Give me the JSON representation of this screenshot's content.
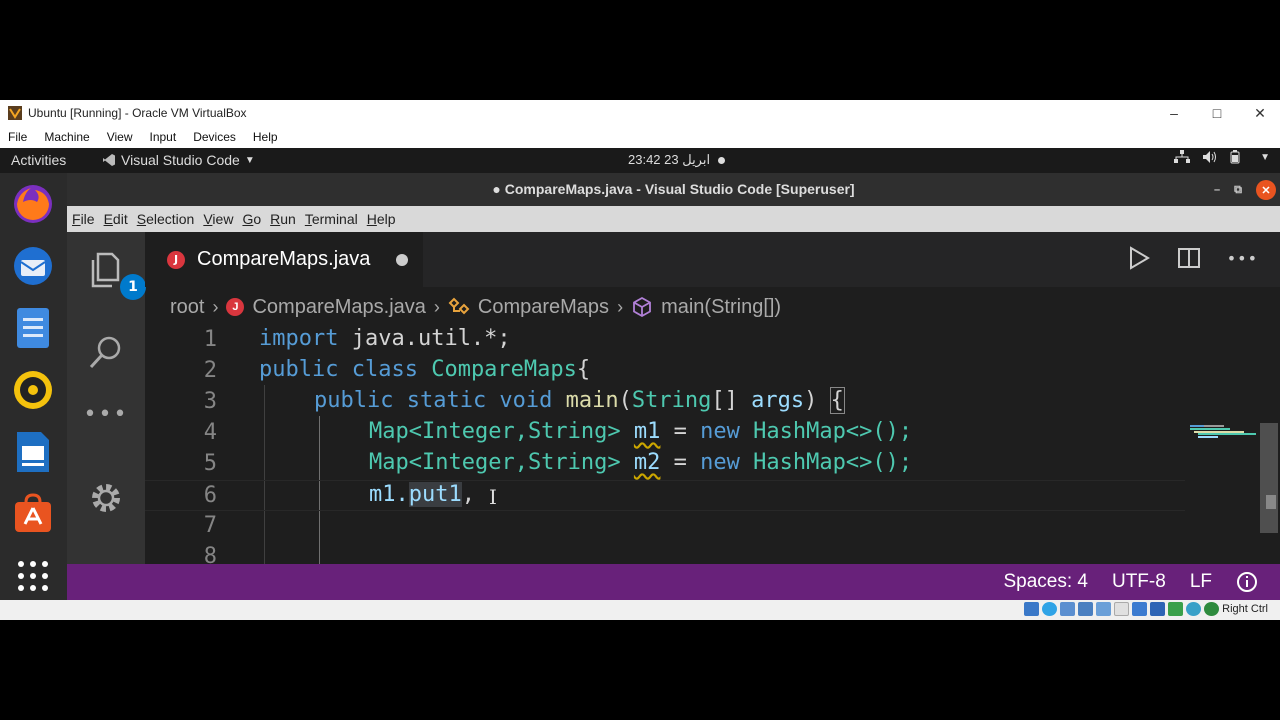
{
  "host_window": {
    "title": "Ubuntu [Running] - Oracle VM VirtualBox",
    "menu": [
      "File",
      "Machine",
      "View",
      "Input",
      "Devices",
      "Help"
    ],
    "host_key": "Right Ctrl"
  },
  "ubuntu_topbar": {
    "activities": "Activities",
    "app_menu": "Visual Studio Code",
    "clock": "23:42  23 ابريل"
  },
  "dock": [
    "firefox-icon",
    "thunderbird-icon",
    "files-icon",
    "rhythmbox-icon",
    "writer-icon",
    "software-icon",
    "apps-grid-icon"
  ],
  "vscode": {
    "title": "CompareMaps.java - Visual Studio Code [Superuser]",
    "menu": [
      "File",
      "Edit",
      "Selection",
      "View",
      "Go",
      "Run",
      "Terminal",
      "Help"
    ],
    "explorer_badge": "1",
    "tab": {
      "label": "CompareMaps.java",
      "icon_letter": "J"
    },
    "breadcrumb": {
      "root": "root",
      "file": "CompareMaps.java",
      "class": "CompareMaps",
      "method": "main(String[])"
    },
    "line_numbers": [
      "1",
      "2",
      "3",
      "4",
      "5",
      "6",
      "7",
      "8"
    ],
    "status": {
      "spaces": "Spaces: 4",
      "encoding": "UTF-8",
      "eol": "LF"
    }
  },
  "colors": {
    "status_bar": "#68217a",
    "editor_bg": "#1e1e1e",
    "keyword": "#569cd6",
    "type": "#4ec9b0",
    "function": "#dcdcaa",
    "variable": "#9cdcfe",
    "java_icon": "#d9363e",
    "ubuntu_orange": "#e95420"
  },
  "code": {
    "l1": {
      "kw": "import",
      "rest": " java.util.*;"
    },
    "l2": {
      "kw": "public class",
      "name": "CompareMaps",
      "rest": "{"
    },
    "l3": {
      "kw": "public static void",
      "fn": "main",
      "open": "(",
      "type": "String",
      "mid": "[] ",
      "param": "args",
      "close": ") ",
      "brace": "{"
    },
    "l4": {
      "type": "Map<Integer,String>",
      "sp": " ",
      "var": "m1",
      "eq": " = ",
      "kw": "new",
      "ctor": " HashMap<>();"
    },
    "l5": {
      "type": "Map<Integer,String>",
      "sp": " ",
      "var": "m2",
      "eq": " = ",
      "kw": "new",
      "ctor": " HashMap<>();"
    },
    "l6": {
      "obj": "m1.",
      "call": "put1",
      "rest": ", "
    }
  }
}
